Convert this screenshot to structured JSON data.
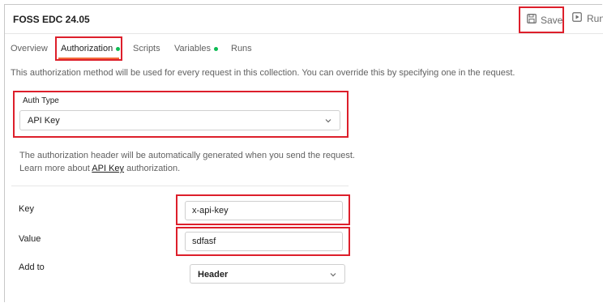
{
  "header": {
    "collection_title": "FOSS EDC 24.05",
    "save_label": "Save",
    "run_label": "Run"
  },
  "tabs": [
    {
      "label": "Overview",
      "dot": false,
      "active": false
    },
    {
      "label": "Authorization",
      "dot": true,
      "active": true
    },
    {
      "label": "Scripts",
      "dot": false,
      "active": false
    },
    {
      "label": "Variables",
      "dot": true,
      "active": false
    },
    {
      "label": "Runs",
      "dot": false,
      "active": false
    }
  ],
  "description": "This authorization method will be used for every request in this collection. You can override this by specifying one in the request.",
  "auth": {
    "label": "Auth Type",
    "selected": "API Key"
  },
  "info": {
    "line1": "The authorization header will be automatically generated when you send the request.",
    "line2_prefix": "Learn more about ",
    "line2_link": "API Key",
    "line2_suffix": " authorization."
  },
  "fields": {
    "key_label": "Key",
    "key_value": "x-api-key",
    "value_label": "Value",
    "value_value": "sdfasf",
    "addto_label": "Add to",
    "addto_selected": "Header"
  },
  "colors": {
    "highlight": "#dd1f2b",
    "tab_accent": "#f26b3a",
    "dot_green": "#0cbb52"
  },
  "icons": {
    "save": "floppy-disk-icon",
    "run": "play-icon",
    "dropdown": "chevron-down-icon"
  }
}
